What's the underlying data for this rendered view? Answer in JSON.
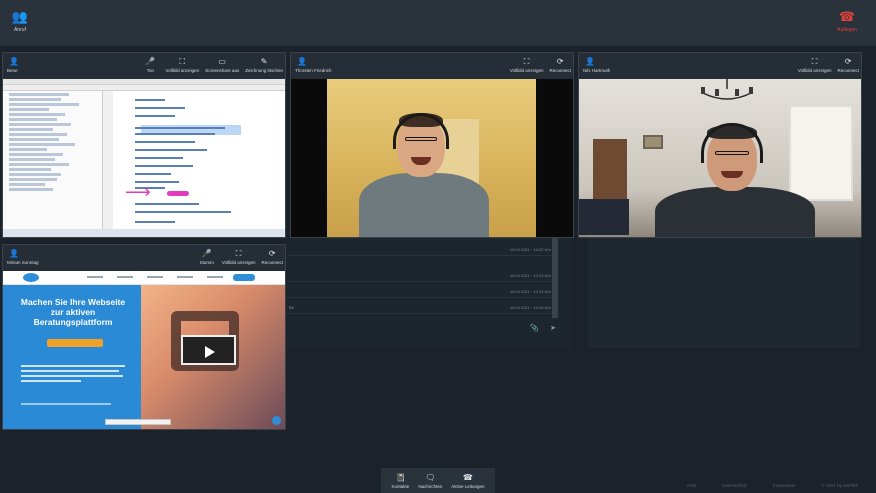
{
  "topbar": {
    "add_call_label": "Anruf",
    "hangup_label": "Auflegen"
  },
  "icons": {
    "add_user": "add-user-icon",
    "phone": "phone-icon",
    "mic": "mic-icon",
    "fullscreen": "fullscreen-icon",
    "screenshare_off": "screenshare-off-icon",
    "pen": "pen-icon",
    "reconnect": "reconnect-icon",
    "person": "person-icon"
  },
  "tiles": {
    "bene": {
      "name": "Bene",
      "actions": [
        "Ton",
        "Vollbild anzeigen",
        "Screenshare aus",
        "Zeichnung löschen"
      ]
    },
    "thorsten": {
      "name": "Thorsten Friedrich",
      "actions": [
        "Vollbild anzeigen",
        "Reconnect"
      ]
    },
    "nils": {
      "name": "Nils Hartmuth",
      "actions": [
        "Vollbild anzeigen",
        "Reconnect"
      ]
    },
    "miriam": {
      "name": "Miriam Sonntag",
      "actions": [
        "Stumm",
        "Vollbild anzeigen",
        "Reconnect"
      ]
    }
  },
  "website": {
    "hero_title": "Machen Sie Ihre Webseite zur aktiven Beratungsplattform"
  },
  "chat": {
    "messages": [
      {
        "time": "19.04.2021 · 14:22 Uhr",
        "snippet": ""
      },
      {
        "time": "19.04.2021 · 14:23 Uhr",
        "snippet": ""
      },
      {
        "time": "19.04.2021 · 14:24 Uhr",
        "snippet": ""
      },
      {
        "time": "19.04.2021 · 14:25 Uhr",
        "snippet": "Bit"
      }
    ]
  },
  "dock": {
    "items": [
      "Kontakte",
      "Nachrichten",
      "Aktive Leitungen"
    ]
  },
  "footer": {
    "links": [
      "AGB",
      "Datenschutz",
      "Impressum",
      "© 2021 by wePBX"
    ]
  },
  "colors": {
    "background": "#1b222a",
    "topbar": "#2a323b",
    "hangup": "#e0413a",
    "web_accent": "#2a8ad6",
    "annotation": "#e33ac0"
  }
}
